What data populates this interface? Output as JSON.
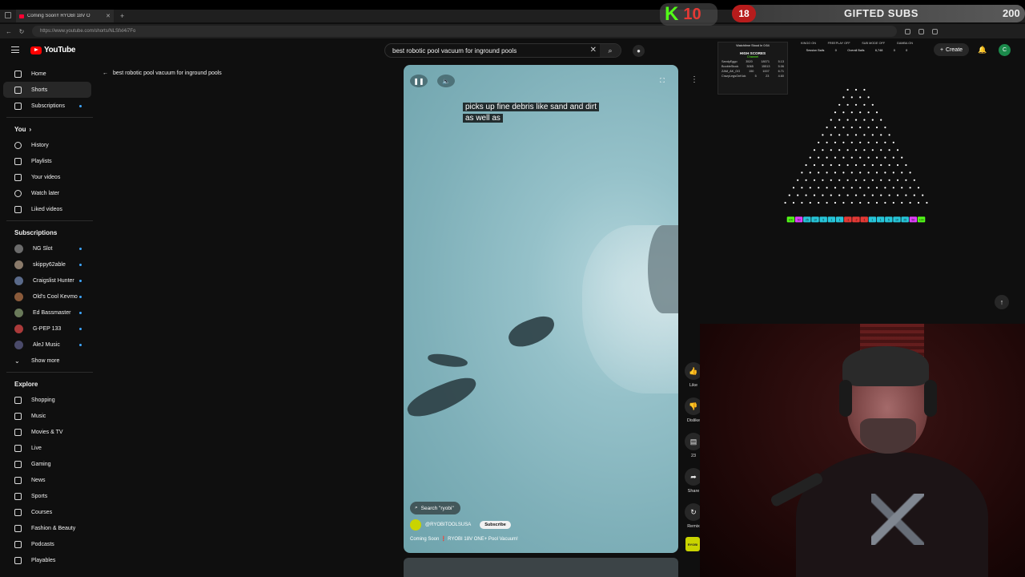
{
  "browser": {
    "tab_title": "Coming Soon!! RYOBI 18V O",
    "url": "https://www.youtube.com/shorts/NLSfxI4i7Fo"
  },
  "stream_overlay": {
    "kick_letter": "K",
    "kick_count": "10",
    "badge_count": "18",
    "gifted_label": "GIFTED SUBS",
    "gifted_count": "200"
  },
  "masthead": {
    "logo_text": "YouTube",
    "search_query": "best robotic pool vacuum for inground pools",
    "create_label": "Create",
    "account_initial": "C"
  },
  "sidebar": {
    "main": [
      {
        "label": "Home",
        "active": false
      },
      {
        "label": "Shorts",
        "active": true
      },
      {
        "label": "Subscriptions",
        "active": false
      }
    ],
    "you_label": "You",
    "you_items": [
      "History",
      "Playlists",
      "Your videos",
      "Watch later",
      "Liked videos"
    ],
    "subscriptions_label": "Subscriptions",
    "subscriptions": [
      {
        "label": "NG Slot",
        "color": "#6b6b6b"
      },
      {
        "label": "skippy62able",
        "color": "#8a7a6a"
      },
      {
        "label": "Craigslist Hunter",
        "color": "#5a6a8a"
      },
      {
        "label": "Old's Cool Kevmo",
        "color": "#8a5a3a"
      },
      {
        "label": "Ed Bassmaster",
        "color": "#6a7a5a"
      },
      {
        "label": "G-PEP 133",
        "color": "#aa3a3a"
      },
      {
        "label": "AleJ Music",
        "color": "#4a4a6a"
      }
    ],
    "show_more_label": "Show more",
    "explore_label": "Explore",
    "explore": [
      "Shopping",
      "Music",
      "Movies & TV",
      "Live",
      "Gaming",
      "News",
      "Sports",
      "Courses",
      "Fashion & Beauty",
      "Podcasts",
      "Playables"
    ]
  },
  "search_back_title": "best robotic pool vacuum for inground pools",
  "short": {
    "caption_line1": "picks up fine debris like sand and dirt",
    "caption_line2": "as well as",
    "search_chip": "Search \"ryobi\"",
    "channel": "@RYOBITOOLSUSA",
    "subscribe_label": "Subscribe",
    "title": "Coming Soon ❗ RYOBI 18V ONE+ Pool Vacuum!"
  },
  "actions": {
    "like_label": "Like",
    "dislike_label": "Dislike",
    "comments_count": "23",
    "share_label": "Share",
    "remix_label": "Remix",
    "channel_thumb_text": "RYOBI"
  },
  "game_overlay": {
    "watchtime_text": "Watchtime Stood In 0:54",
    "high_scores_label": "HIGH SCORES",
    "channel_label": "Channel",
    "scores": [
      {
        "name": "SandyEggo",
        "a": "3520",
        "b": "18071",
        "c": "5.13"
      },
      {
        "name": "BoobleStock",
        "a": "3065",
        "b": "15513",
        "c": "5.06"
      },
      {
        "name": "ZAM_AK_OG",
        "a": "150",
        "b": "1007",
        "c": "6.71"
      },
      {
        "name": "CrazyLegsOnKick",
        "a": "5",
        "b": "23",
        "a2": "",
        "c": "4.60"
      }
    ],
    "stat_labels": [
      "KINGO ON",
      "FREEPLAY OFF",
      "SUB MODE OFF",
      "GAMBA ON"
    ],
    "session_balls_label": "Session Balls",
    "session_balls": "0",
    "overall_balls_label": "Overall Balls",
    "overall_balls": "6,748",
    "extra_a": "0",
    "extra_b": "0",
    "slots": [
      {
        "v": "100",
        "c": "#53fc18"
      },
      {
        "v": "50",
        "c": "#e040fb"
      },
      {
        "v": "25",
        "c": "#26c6da"
      },
      {
        "v": "10",
        "c": "#26c6da"
      },
      {
        "v": "5",
        "c": "#26c6da"
      },
      {
        "v": "1",
        "c": "#26c6da"
      },
      {
        "v": "1",
        "c": "#26c6da"
      },
      {
        "v": "-1",
        "c": "#e53935"
      },
      {
        "v": "-2",
        "c": "#e53935"
      },
      {
        "v": "-1",
        "c": "#e53935"
      },
      {
        "v": "1",
        "c": "#26c6da"
      },
      {
        "v": "1",
        "c": "#26c6da"
      },
      {
        "v": "5",
        "c": "#26c6da"
      },
      {
        "v": "10",
        "c": "#26c6da"
      },
      {
        "v": "25",
        "c": "#26c6da"
      },
      {
        "v": "50",
        "c": "#e040fb"
      },
      {
        "v": "100",
        "c": "#53fc18"
      }
    ]
  },
  "icons": {
    "pause": "❚❚",
    "volume": "🔈",
    "fullscreen": "⛶",
    "more": "⋮",
    "like": "👍",
    "dislike": "👎",
    "comment": "▤",
    "share": "➦",
    "remix": "↻",
    "bell": "🔔",
    "up": "↑",
    "back": "←",
    "search": "⌕",
    "mic": "●",
    "clear": "✕",
    "chevron": "›",
    "chevron_down": "⌄"
  }
}
